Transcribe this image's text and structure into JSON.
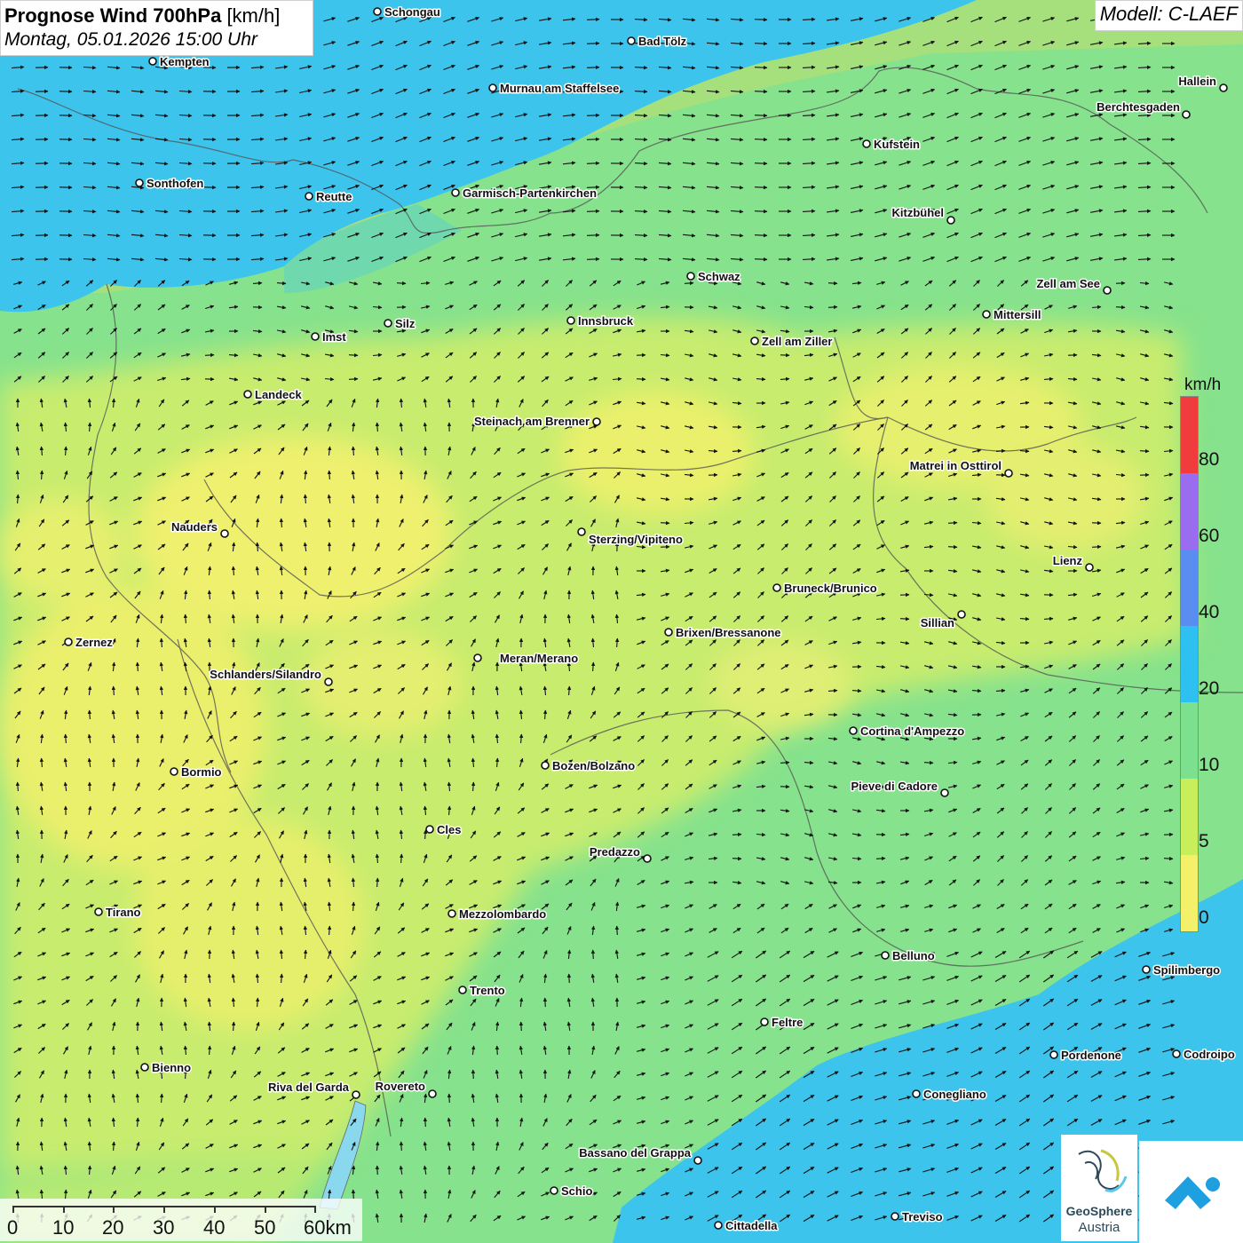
{
  "header": {
    "title": "Prognose Wind 700hPa",
    "title_unit": "[km/h]",
    "datetime": "Montag, 05.01.2026 15:00 Uhr",
    "model": "Modell: C-LAEF"
  },
  "legend": {
    "unit": "km/h",
    "labels": [
      "80",
      "60",
      "40",
      "20",
      "10",
      "5",
      "0"
    ],
    "colors": [
      "#f03c3c",
      "#9a6df0",
      "#5a8df0",
      "#2ec0f0",
      "#7de08f",
      "#c8ee5c",
      "#f4f06a"
    ]
  },
  "scale_bar": {
    "labels": [
      "0",
      "10",
      "20",
      "30",
      "40",
      "50",
      "60km"
    ]
  },
  "logos": {
    "geosphere_line1": "GeoSphere",
    "geosphere_line2": "Austria"
  },
  "cities": [
    {
      "name": "Schongau"
    },
    {
      "name": "Bad Tölz"
    },
    {
      "name": "Kempten"
    },
    {
      "name": "Murnau am Staffelsee"
    },
    {
      "name": "Hallein"
    },
    {
      "name": "Berchtesgaden"
    },
    {
      "name": "Kufstein"
    },
    {
      "name": "Sonthofen"
    },
    {
      "name": "Reutte"
    },
    {
      "name": "Garmisch-Partenkirchen"
    },
    {
      "name": "Kitzbühel"
    },
    {
      "name": "Schwaz"
    },
    {
      "name": "Zell am See"
    },
    {
      "name": "Innsbruck"
    },
    {
      "name": "Mittersill"
    },
    {
      "name": "Silz"
    },
    {
      "name": "Imst"
    },
    {
      "name": "Zell am Ziller"
    },
    {
      "name": "Landeck"
    },
    {
      "name": "Steinach am Brenner"
    },
    {
      "name": "Matrei in Osttirol"
    },
    {
      "name": "Nauders"
    },
    {
      "name": "Sterzing/Vipiteno"
    },
    {
      "name": "Lienz"
    },
    {
      "name": "Bruneck/Brunico"
    },
    {
      "name": "Sillian"
    },
    {
      "name": "Brixen/Bressanone"
    },
    {
      "name": "Zernez"
    },
    {
      "name": "Meran/Merano"
    },
    {
      "name": "Schlanders/Silandro"
    },
    {
      "name": "Cortina d'Ampezzo"
    },
    {
      "name": "Bozen/Bolzano"
    },
    {
      "name": "Bormio"
    },
    {
      "name": "Pieve di Cadore"
    },
    {
      "name": "Cles"
    },
    {
      "name": "Predazzo"
    },
    {
      "name": "Tirano"
    },
    {
      "name": "Mezzolombardo"
    },
    {
      "name": "Belluno"
    },
    {
      "name": "Spilimbergo"
    },
    {
      "name": "Trento"
    },
    {
      "name": "Feltre"
    },
    {
      "name": "Pordenone"
    },
    {
      "name": "Codroipo"
    },
    {
      "name": "Bienno"
    },
    {
      "name": "Riva del Garda"
    },
    {
      "name": "Rovereto"
    },
    {
      "name": "Conegliano"
    },
    {
      "name": "Bassano del Grappa"
    },
    {
      "name": "Schio"
    },
    {
      "name": "Treviso"
    },
    {
      "name": "Cittadella"
    }
  ]
}
